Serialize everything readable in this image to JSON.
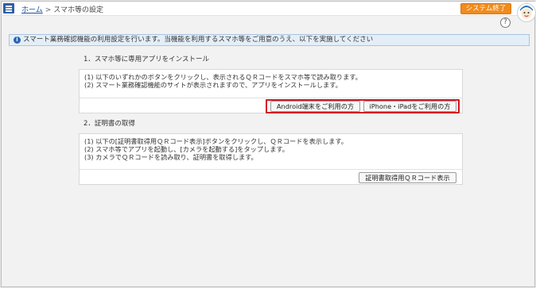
{
  "header": {
    "home_link": "ホーム",
    "separator": ">",
    "current_page": "スマホ等の設定",
    "system_end_button": "システム終了",
    "help_icon_glyph": "?"
  },
  "info_banner": {
    "icon_glyph": "i",
    "text": "スマート業務確認機能の利用設定を行います。当機能を利用するスマホ等をご用意のうえ、以下を実施してください"
  },
  "section1": {
    "title": "1．スマホ等に専用アプリをインストール",
    "lines": [
      "(1) 以下のいずれかのボタンをクリックし、表示されるＱＲコードをスマホ等で読み取ります。",
      "(2) スマート業務確認機能のサイトが表示されますので、アプリをインストールします。"
    ],
    "android_button": "Android端末をご利用の方",
    "iphone_button": "iPhone・iPadをご利用の方"
  },
  "section2": {
    "title": "2．証明書の取得",
    "lines": [
      "(1) 以下の[証明書取得用ＱＲコード表示]ボタンをクリックし、ＱＲコードを表示します。",
      "(2) スマホ等でアプリを起動し、[カメラを起動する]をタップします。",
      "(3) カメラでＱＲコードを読み取り、証明書を取得します。"
    ],
    "qr_button": "証明書取得用ＱＲコード表示"
  },
  "colors": {
    "menu_button": "#2f5fa8",
    "system_end_button": "#f08b1d",
    "highlight_border": "#d8121f",
    "info_banner_bg": "#e4eef8"
  }
}
